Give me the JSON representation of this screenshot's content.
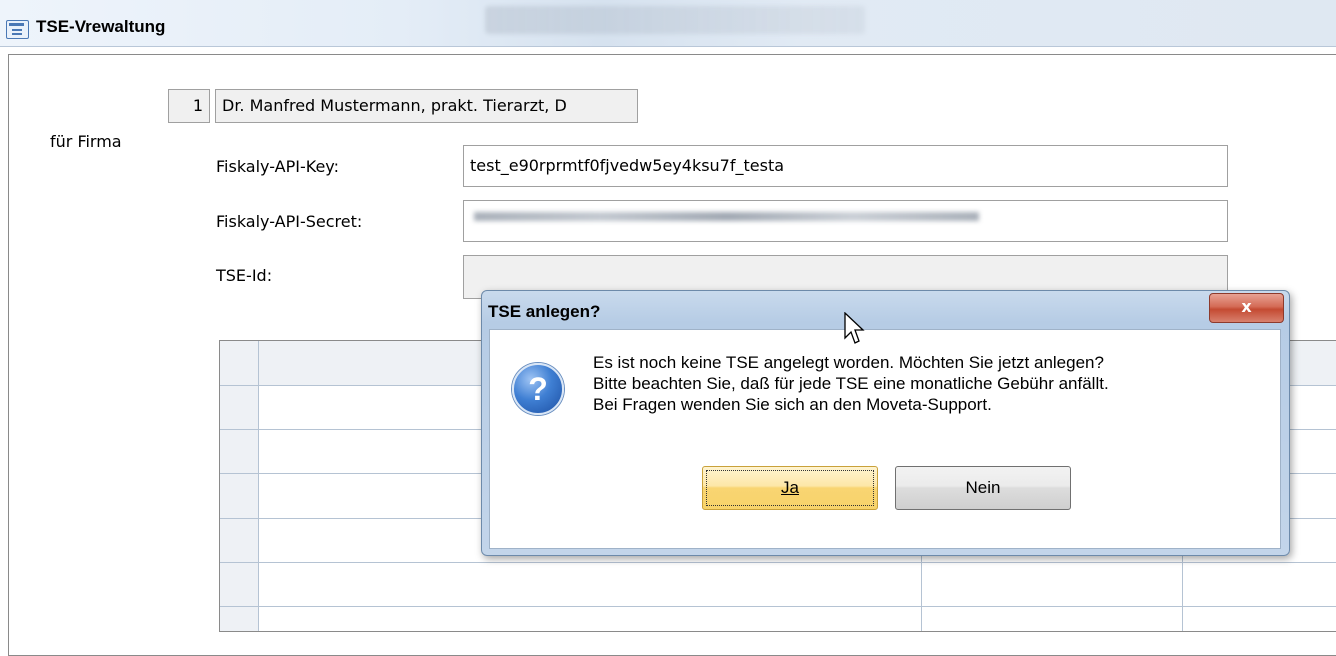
{
  "window": {
    "title": "TSE-Vrewaltung"
  },
  "form": {
    "firma_label": "für Firma",
    "firma_number": "1",
    "firma_name": "Dr. Manfred Mustermann, prakt. Tierarzt, D",
    "api_key_label": "Fiskaly-API-Key:",
    "api_key_value": "test_e90rprmtf0fjvedw5ey4ksu7f_testa",
    "api_secret_label": "Fiskaly-API-Secret:",
    "tse_id_label": "TSE-Id:",
    "tse_id_value": ""
  },
  "dialog": {
    "title": "TSE anlegen?",
    "close_label": "x",
    "message_lines": [
      "Es ist noch keine TSE angelegt worden. Möchten Sie jetzt anlegen?",
      "Bitte beachten Sie, daß für jede TSE eine monatliche Gebühr anfällt.",
      "Bei Fragen wenden Sie sich an den Moveta-Support."
    ],
    "icon": "question-icon",
    "yes_label": "Ja",
    "no_label": "Nein"
  }
}
